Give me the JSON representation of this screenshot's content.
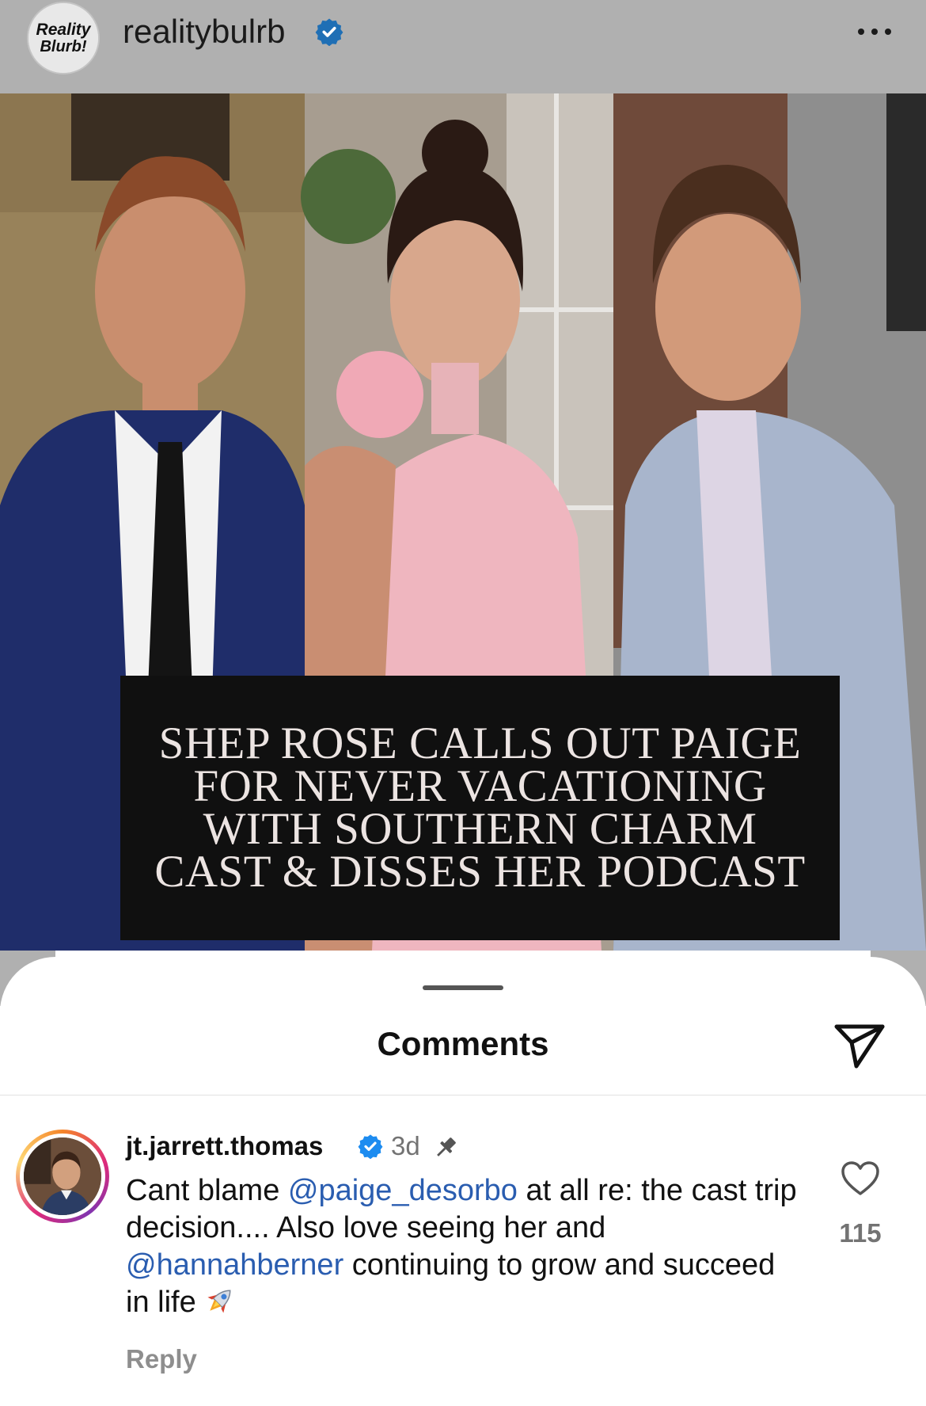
{
  "header": {
    "username": "realitybulrb",
    "logo_text_line1": "Reality",
    "logo_text_line2": "Blurb!",
    "more_icon": "more-horizontal-icon",
    "verified_icon": "verified-badge-icon"
  },
  "post": {
    "headline": "SHEP ROSE CALLS OUT PAIGE FOR NEVER VACATIONING WITH SOUTHERN CHARM CAST & DISSES HER PODCAST"
  },
  "comments_sheet": {
    "title": "Comments",
    "share_icon": "send-paper-plane-icon"
  },
  "comment": {
    "username": "jt.jarrett.thomas",
    "time": "3d",
    "text_part1": "Cant blame ",
    "mention1": "@paige_desorbo",
    "text_part2": " at all re: the cast trip decision.... Also love seeing her and ",
    "mention2": "@hannahberner",
    "text_part3": " continuing to grow and succeed in life",
    "emoji": "rocket-emoji",
    "reply_label": "Reply",
    "like_count": "115",
    "like_icon": "heart-outline-icon",
    "pin_icon": "pin-icon"
  },
  "colors": {
    "mention": "#2a5db0",
    "verified": "#1d8cf0",
    "muted": "#737373"
  }
}
